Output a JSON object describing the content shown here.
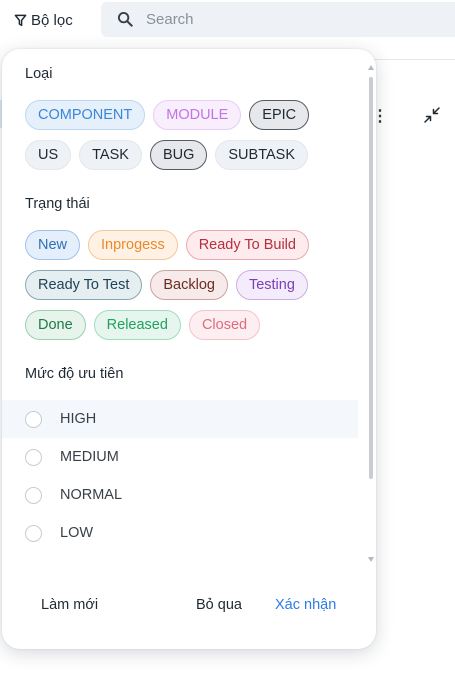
{
  "topbar": {
    "filter_label": "Bộ lọc",
    "search_placeholder": "Search"
  },
  "filter_panel": {
    "type_section": {
      "title": "Loại",
      "chips": [
        {
          "label": "COMPONENT",
          "selected": false,
          "bg": "#e5f0fb",
          "border": "#bcd7f3",
          "color": "#3b86d8"
        },
        {
          "label": "MODULE",
          "selected": false,
          "bg": "#f8eefc",
          "border": "#e8cdf5",
          "color": "#c175e6"
        },
        {
          "label": "EPIC",
          "selected": true,
          "bg": "#e6e8eb",
          "border": "#555b63",
          "color": "#1f2933"
        },
        {
          "label": "US",
          "selected": false,
          "bg": "#eef2f6",
          "border": "#e2e7ec",
          "color": "#1f2933"
        },
        {
          "label": "TASK",
          "selected": false,
          "bg": "#eef2f6",
          "border": "#e2e7ec",
          "color": "#1f2933"
        },
        {
          "label": "BUG",
          "selected": true,
          "bg": "#e6e8eb",
          "border": "#555b63",
          "color": "#1f2933"
        },
        {
          "label": "SUBTASK",
          "selected": false,
          "bg": "#eef2f6",
          "border": "#e2e7ec",
          "color": "#1f2933"
        }
      ]
    },
    "status_section": {
      "title": "Trạng thái",
      "chips": [
        {
          "label": "New",
          "bg": "#e4effb",
          "border": "#9fc3ea",
          "color": "#2f6fb8"
        },
        {
          "label": "Inprogess",
          "bg": "#fff2e4",
          "border": "#f5c79a",
          "color": "#e88a2c"
        },
        {
          "label": "Ready To Build",
          "bg": "#fdebee",
          "border": "#e9a9b2",
          "color": "#b4303f"
        },
        {
          "label": "Ready To Test",
          "bg": "#e5eef1",
          "border": "#8aa7b3",
          "color": "#1f4455"
        },
        {
          "label": "Backlog",
          "bg": "#f6ebea",
          "border": "#c9a4a0",
          "color": "#6e2b24"
        },
        {
          "label": "Testing",
          "bg": "#f4ecfb",
          "border": "#c9aee6",
          "color": "#7a3fb6"
        },
        {
          "label": "Done",
          "bg": "#e6f4ec",
          "border": "#9cd0b2",
          "color": "#1f7a4a"
        },
        {
          "label": "Released",
          "bg": "#e6f6ee",
          "border": "#9fdcbc",
          "color": "#22a05f"
        },
        {
          "label": "Closed",
          "bg": "#fdeff1",
          "border": "#f2c3ca",
          "color": "#e06b7c"
        }
      ]
    },
    "priority_section": {
      "title": "Mức độ ưu tiên",
      "options": [
        {
          "label": "HIGH",
          "hovered": true
        },
        {
          "label": "MEDIUM",
          "hovered": false
        },
        {
          "label": "NORMAL",
          "hovered": false
        },
        {
          "label": "LOW",
          "hovered": false
        }
      ]
    },
    "footer": {
      "reset_label": "Làm mới",
      "skip_label": "Bỏ qua",
      "confirm_label": "Xác nhận"
    }
  },
  "colors": {
    "accent": "#2d7be5",
    "selected_chip_border": "#555b63",
    "search_bg": "#eef2f6"
  },
  "icons": {
    "filter": "filter-icon",
    "search": "search-icon",
    "more": "more-vertical-icon",
    "collapse": "collapse-icon"
  }
}
